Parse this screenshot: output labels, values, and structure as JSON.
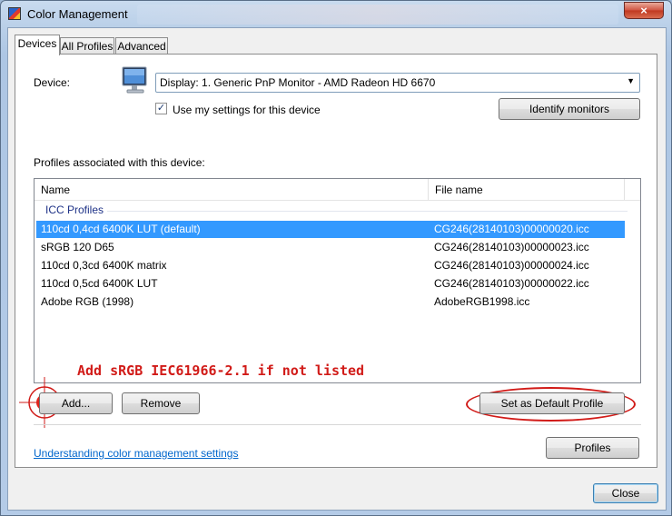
{
  "window": {
    "title": "Color Management",
    "close_glyph": "×"
  },
  "tabs": [
    {
      "label": "Devices"
    },
    {
      "label": "All Profiles"
    },
    {
      "label": "Advanced"
    }
  ],
  "device": {
    "label": "Device:",
    "selected": "Display: 1. Generic PnP Monitor - AMD Radeon HD 6670",
    "use_my_settings_label": "Use my settings for this device",
    "use_my_settings_checked": true,
    "identify_button": "Identify monitors"
  },
  "profiles": {
    "section_label": "Profiles associated with this device:",
    "columns": [
      "Name",
      "File name"
    ],
    "group": "ICC Profiles",
    "rows": [
      {
        "name": "110cd 0,4cd 6400K LUT (default)",
        "file": "CG246(28140103)00000020.icc",
        "selected": true
      },
      {
        "name": "sRGB 120 D65",
        "file": "CG246(28140103)00000023.icc",
        "selected": false
      },
      {
        "name": "110cd 0,3cd  6400K matrix",
        "file": "CG246(28140103)00000024.icc",
        "selected": false
      },
      {
        "name": "110cd 0,5cd  6400K LUT",
        "file": "CG246(28140103)00000022.icc",
        "selected": false
      },
      {
        "name": "Adobe RGB (1998)",
        "file": "AdobeRGB1998.icc",
        "selected": false
      }
    ]
  },
  "annotation": {
    "text": "Add sRGB IEC61966-2.1 if not listed",
    "color": "#d11b18"
  },
  "buttons": {
    "add": "Add...",
    "remove": "Remove",
    "set_default": "Set as Default Profile",
    "profiles": "Profiles",
    "close": "Close"
  },
  "link": {
    "text": "Understanding color management settings"
  },
  "colors": {
    "selection": "#3399ff",
    "link": "#0066cc",
    "group_header": "#1e3287"
  }
}
